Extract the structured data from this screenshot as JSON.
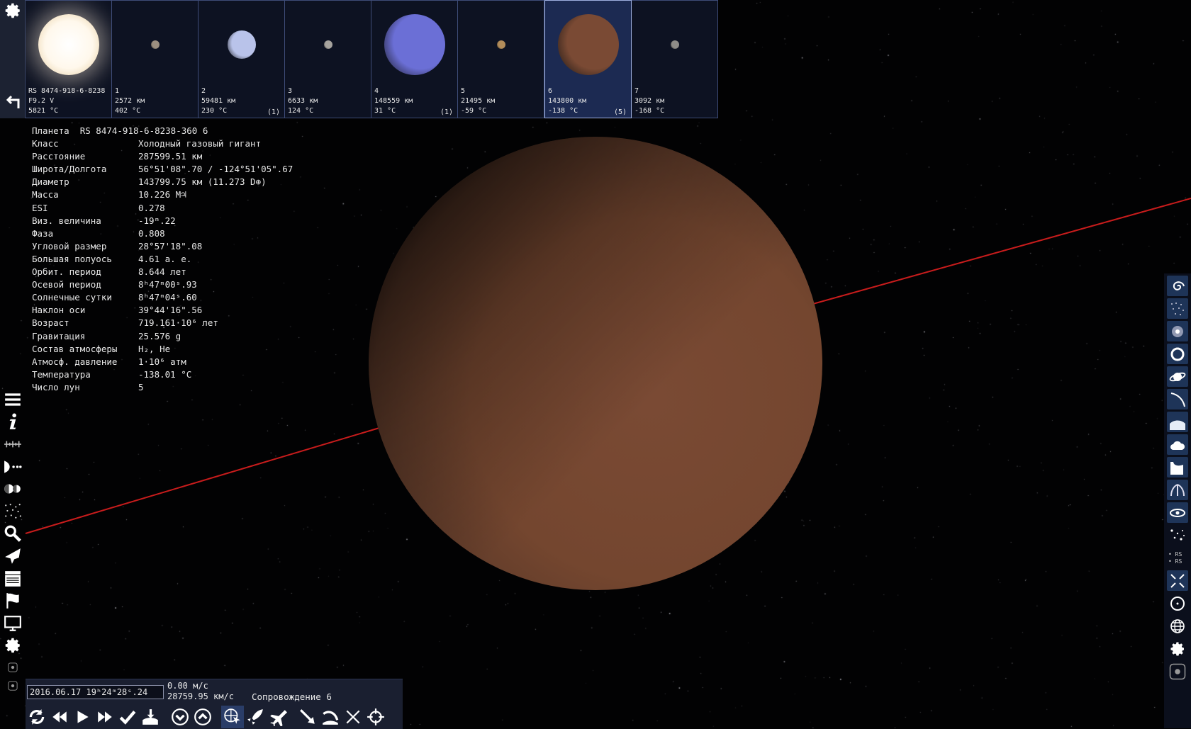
{
  "strip": {
    "settings_icon": "gear-icon",
    "back_icon": "back-arrow-icon",
    "bodies": [
      {
        "l1": "RS 8474-918-6-8238",
        "l2": "F9.2 V",
        "l3": "5821 °C",
        "moons": "",
        "kind": "star",
        "color": "#fff6e0"
      },
      {
        "l1": "1",
        "l2": "2572 км",
        "l3": "402 °C",
        "moons": "",
        "kind": "small",
        "color": "#9c8f80"
      },
      {
        "l1": "2",
        "l2": "59481 км",
        "l3": "230 °C",
        "moons": "(1)",
        "kind": "medium",
        "color": "#b9c3ea"
      },
      {
        "l1": "3",
        "l2": "6633 км",
        "l3": "124 °C",
        "moons": "",
        "kind": "small",
        "color": "#a6a39e"
      },
      {
        "l1": "4",
        "l2": "148559 км",
        "l3": "31 °C",
        "moons": "(1)",
        "kind": "large",
        "color": "#6b6fd6"
      },
      {
        "l1": "5",
        "l2": "21495 км",
        "l3": "-59 °C",
        "moons": "",
        "kind": "small",
        "color": "#b28c5a"
      },
      {
        "l1": "6",
        "l2": "143800 км",
        "l3": "-138 °C",
        "moons": "(5)",
        "kind": "large",
        "color": "#7a4a34",
        "selected": true
      },
      {
        "l1": "7",
        "l2": "3092 км",
        "l3": "-168 °C",
        "moons": "",
        "kind": "small",
        "color": "#8e8c88"
      }
    ]
  },
  "info": {
    "title": "Планета  RS 8474-918-6-8238-360 6",
    "rows": [
      {
        "k": "Класс",
        "v": "Холодный газовый гигант"
      },
      {
        "k": "Расстояние",
        "v": "287599.51 км"
      },
      {
        "k": "Широта/Долгота",
        "v": "56°51'08\".70 / -124°51'05\".67"
      },
      {
        "k": "Диаметр",
        "v": "143799.75 км (11.273 D⊕)"
      },
      {
        "k": "Масса",
        "v": "10.226 M♃"
      },
      {
        "k": "ESI",
        "v": "0.278"
      },
      {
        "k": "Виз. величина",
        "v": "-19ᵐ.22"
      },
      {
        "k": "Фаза",
        "v": "0.808"
      },
      {
        "k": "Угловой размер",
        "v": "28°57'18\".08"
      },
      {
        "k": "Большая полуось",
        "v": "4.61 а. е."
      },
      {
        "k": "Орбит. период",
        "v": "8.644 лет"
      },
      {
        "k": "Осевой период",
        "v": "8ʰ47ᵐ00ˢ.93"
      },
      {
        "k": "Солнечные сутки",
        "v": "8ʰ47ᵐ04ˢ.60"
      },
      {
        "k": "Наклон оси",
        "v": "39°44'16\".56"
      },
      {
        "k": "Возраст",
        "v": "719.161·10⁶ лет"
      },
      {
        "k": "Гравитация",
        "v": "25.576 g"
      },
      {
        "k": "Состав атмосферы",
        "v": "H₂, He"
      },
      {
        "k": "Атмосф. давление",
        "v": "1·10⁶ атм"
      },
      {
        "k": "Температура",
        "v": "-138.01 °C"
      },
      {
        "k": "Число лун",
        "v": "5"
      }
    ]
  },
  "bottom": {
    "datetime": "2016.06.17  19ʰ24ᵐ28ˢ.24",
    "speed1": "0.00 м/с",
    "speed2": "28759.95 км/с",
    "follow": "Сопровождение 6"
  },
  "left_tools": [
    "menu-icon",
    "info-icon",
    "ruler-icon",
    "orbit-icon",
    "planet-pair-icon",
    "star-field-icon",
    "search-icon",
    "ship-icon",
    "clapper-icon",
    "flag-icon",
    "monitor-icon",
    "gear-icon"
  ],
  "right_tools": [
    "spiral-galaxy-icon",
    "nebula-icon",
    "star-cluster-icon",
    "ring-galaxy-icon",
    "planet-ring-icon",
    "orbit-arc-icon",
    "atmosphere-icon",
    "clouds-icon",
    "water-icon",
    "aurora-icon",
    "eye-icon",
    "stars-icon",
    "labels-rs-icon",
    "fullscreen-icon",
    "target-icon",
    "globe-icon",
    "gear-icon"
  ],
  "rs_labels": [
    "• RS",
    "• RS"
  ],
  "colors": {
    "planet": "#7a4a34",
    "orbit": "#c81c1c",
    "panel": "#1a1f30"
  }
}
